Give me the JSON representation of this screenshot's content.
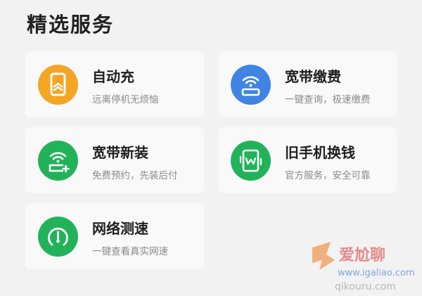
{
  "section": {
    "title": "精选服务"
  },
  "services": [
    {
      "title": "自动充",
      "subtitle": "远离停机无烦恼",
      "icon": "phone-recharge-icon",
      "color": "#f5a524"
    },
    {
      "title": "宽带缴费",
      "subtitle": "一键查询，极速缴费",
      "icon": "wifi-router-icon",
      "color": "#3f84e5"
    },
    {
      "title": "宽带新装",
      "subtitle": "免费预约，先装后付",
      "icon": "wifi-router-plus-icon",
      "color": "#22b35a"
    },
    {
      "title": "旧手机换钱",
      "subtitle": "官方服务，安全可靠",
      "icon": "phone-trade-in-icon",
      "color": "#22b35a"
    },
    {
      "title": "网络测速",
      "subtitle": "一键查看真实网速",
      "icon": "speedometer-icon",
      "color": "#22b35a"
    }
  ],
  "watermark": {
    "brand": "爱尬聊",
    "url": "www.igaliao.com",
    "extra": "qikouru.com"
  }
}
